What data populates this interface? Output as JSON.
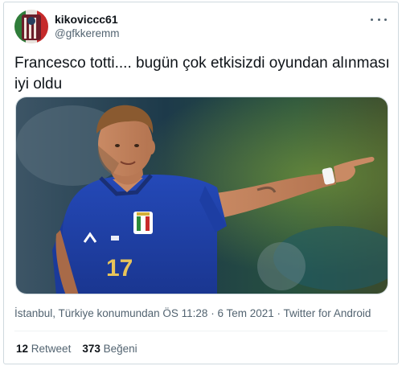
{
  "user": {
    "display_name": "kikoviccc61",
    "handle": "@gfkkeremm"
  },
  "tweet": {
    "text": "Francesco totti.... bugün çok etkisizdi oyundan alınması iyi oldu",
    "photo_description": "",
    "jersey_number": "17"
  },
  "meta": {
    "location": "İstanbul, Türkiye konumundan",
    "time": "ÖS 11:28",
    "separator": "·",
    "date": "6 Tem 2021",
    "source": "Twitter for Android"
  },
  "stats": {
    "retweets_count": "12",
    "retweets_label": "Retweet",
    "likes_count": "373",
    "likes_label": "Beğeni"
  },
  "colors": {
    "text_primary": "#0f1419",
    "text_secondary": "#536471",
    "border": "#cfd9de",
    "jersey_blue": "#1f3fa8"
  },
  "icons": {
    "more": "more-horizontal-icon"
  }
}
